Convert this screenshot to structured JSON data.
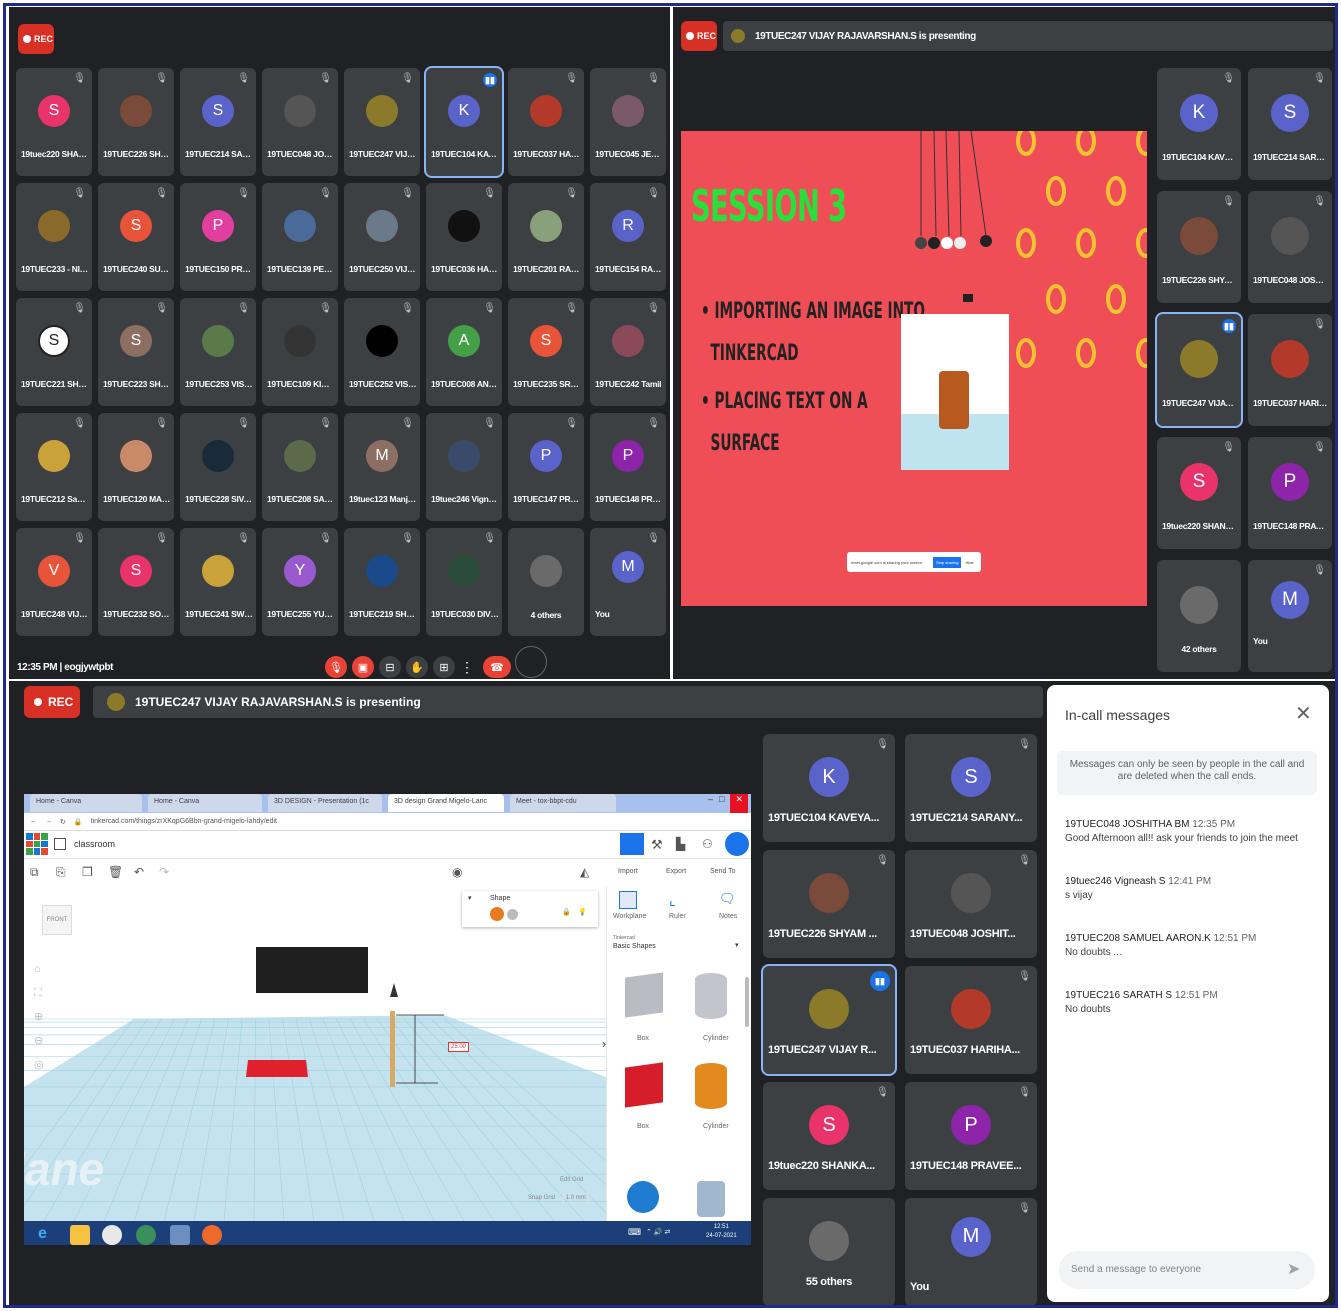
{
  "rec_label": "REC",
  "panel_tl": {
    "time_code": "12:35 PM | eogjywtpbt",
    "tiles": [
      {
        "name": "19tuec220 SHAN...",
        "initial": "S",
        "color": "#e8336b"
      },
      {
        "name": "19TUEC226 SHYA...",
        "initial": "",
        "color": "#7a4a3a"
      },
      {
        "name": "19TUEC214 SARA...",
        "initial": "S",
        "color": "#5a63c9"
      },
      {
        "name": "19TUEC048 JOSH...",
        "initial": "",
        "color": "#555555"
      },
      {
        "name": "19TUEC247 VIJAY...",
        "initial": "",
        "color": "#8a7a2a"
      },
      {
        "name": "19TUEC104 KAVE...",
        "initial": "K",
        "color": "#5a63c9",
        "active": true
      },
      {
        "name": "19TUEC037 HARI...",
        "initial": "",
        "color": "#b33a2a"
      },
      {
        "name": "19TUEC045 JENIF...",
        "initial": "",
        "color": "#7a5a6a"
      },
      {
        "name": "19TUEC233 - NIT...",
        "initial": "",
        "color": "#8a6a2a"
      },
      {
        "name": "19TUEC240 SUSH...",
        "initial": "S",
        "color": "#e8543a"
      },
      {
        "name": "19TUEC150 PREE...",
        "initial": "P",
        "color": "#e03fa0"
      },
      {
        "name": "19TUEC139 PERIN...",
        "initial": "",
        "color": "#4a6a9a"
      },
      {
        "name": "19TUEC250 VIJAY...",
        "initial": "",
        "color": "#6a7a8a"
      },
      {
        "name": "19TUEC036 HARE...",
        "initial": "",
        "color": "#111111"
      },
      {
        "name": "19TUEC201 RANJ...",
        "initial": "",
        "color": "#8aa07a"
      },
      {
        "name": "19TUEC154 RAJA ...",
        "initial": "R",
        "color": "#5a63c9"
      },
      {
        "name": "19TUEC221 SHAN...",
        "initial": "S",
        "color": "#ffffff",
        "dark": true
      },
      {
        "name": "19TUEC223 SHRE...",
        "initial": "S",
        "color": "#8d6e63"
      },
      {
        "name": "19TUEC253 VISH...",
        "initial": "",
        "color": "#5a7a4a"
      },
      {
        "name": "19TUEC109 KIRA...",
        "initial": "",
        "color": "#333333"
      },
      {
        "name": "19TUEC252 VISH...",
        "initial": "",
        "color": "#000000"
      },
      {
        "name": "19TUEC008 ANN ...",
        "initial": "A",
        "color": "#43a047"
      },
      {
        "name": "19TUEC235 SRUT...",
        "initial": "S",
        "color": "#e8543a"
      },
      {
        "name": "19TUEC242 Tamil",
        "initial": "",
        "color": "#8a4a5a"
      },
      {
        "name": "19TUEC212 Sanka...",
        "initial": "",
        "color": "#c9a33a"
      },
      {
        "name": "19TUEC120 MAD...",
        "initial": "",
        "color": "#c98a6a"
      },
      {
        "name": "19TUEC228 SIVA...",
        "initial": "",
        "color": "#1a2a3a"
      },
      {
        "name": "19TUEC208 SAM...",
        "initial": "",
        "color": "#5a6a4a"
      },
      {
        "name": "19tuec123 Manjul...",
        "initial": "M",
        "color": "#8d6e63"
      },
      {
        "name": "19tuec246 Vigne...",
        "initial": "",
        "color": "#3a4a6a"
      },
      {
        "name": "19TUEC147 PRAV...",
        "initial": "P",
        "color": "#5a63c9"
      },
      {
        "name": "19TUEC148 PRAV...",
        "initial": "P",
        "color": "#8e24aa"
      },
      {
        "name": "19TUEC248 VIJAY...",
        "initial": "V",
        "color": "#e8543a"
      },
      {
        "name": "19TUEC232 SOW...",
        "initial": "S",
        "color": "#e8336b"
      },
      {
        "name": "19TUEC241 SWED...",
        "initial": "",
        "color": "#c9a33a"
      },
      {
        "name": "19TUEC255 YUVA...",
        "initial": "Y",
        "color": "#9b59d0"
      },
      {
        "name": "19TUEC219 SHAN...",
        "initial": "",
        "color": "#1a4a8a"
      },
      {
        "name": "19TUEC030 DIVY...",
        "initial": "",
        "color": "#2a4a3a"
      },
      {
        "name": "4 others",
        "initial": "",
        "color": "#6a6a6a",
        "others": true
      },
      {
        "name": "You",
        "initial": "M",
        "color": "#5a63c9",
        "you": true
      }
    ]
  },
  "panel_tr": {
    "presenting": "19TUEC247 VIJAY RAJAVARSHAN.S is presenting",
    "slide": {
      "title": "SESSION 3",
      "bullet1_line1": "IMPORTING AN IMAGE INTO",
      "bullet1_line2": "TINKERCAD",
      "bullet2_line1": "PLACING TEXT ON A",
      "bullet2_line2": "SURFACE",
      "share_text": "meet.google.com is sharing your screen",
      "stop_sharing": "Stop sharing",
      "hide": "Hide"
    },
    "tiles": [
      {
        "name": "19TUEC104 KAVEYA...",
        "initial": "K",
        "color": "#5a63c9"
      },
      {
        "name": "19TUEC214 SARANY...",
        "initial": "S",
        "color": "#5a63c9"
      },
      {
        "name": "19TUEC226 SHYAM ...",
        "initial": "",
        "color": "#7a4a3a"
      },
      {
        "name": "19TUEC048 JOSHIT...",
        "initial": "",
        "color": "#555555"
      },
      {
        "name": "19TUEC247 VIJAY R...",
        "initial": "",
        "color": "#8a7a2a",
        "active": true
      },
      {
        "name": "19TUEC037 HARIHA...",
        "initial": "",
        "color": "#b33a2a"
      },
      {
        "name": "19tuec220 SHANKA...",
        "initial": "S",
        "color": "#e8336b"
      },
      {
        "name": "19TUEC148 PRAVEE...",
        "initial": "P",
        "color": "#8e24aa"
      },
      {
        "name": "42 others",
        "initial": "",
        "color": "#6a6a6a",
        "others": true
      },
      {
        "name": "You",
        "initial": "M",
        "color": "#5a63c9",
        "you": true
      }
    ]
  },
  "panel_bottom": {
    "presenting": "19TUEC247 VIJAY RAJAVARSHAN.S is presenting",
    "browser": {
      "tabs": [
        "Home - Canva",
        "Home - Canva",
        "3D DESIGN - Presentation (1c",
        "3D design Grand Migelo-Lanc",
        "Meet - tox-bbpt-cdu"
      ],
      "url": "tinkercad.com/things/zrXKqpG6Bbn-grand-migelo-lahdy/edit",
      "project": "classroom",
      "import": "Import",
      "export": "Export",
      "send_to": "Send To",
      "workplane": "Workplane",
      "ruler": "Ruler",
      "notes": "Notes",
      "category_small": "Tinkercad",
      "category": "Basic Shapes",
      "shape_label": "Shape",
      "front_label": "FRONT",
      "dimension": "25.00",
      "plane_text": "plane",
      "edit_grid": "Edit Grid",
      "snap_grid": "Snap Grid",
      "snap_value": "1.0 mm",
      "shapes": [
        "Box",
        "Cylinder",
        "Box",
        "Cylinder"
      ],
      "clock_time": "12:51",
      "clock_date": "24-07-2021"
    },
    "tiles": [
      {
        "name": "19TUEC104 KAVEYA...",
        "initial": "K",
        "color": "#5a63c9"
      },
      {
        "name": "19TUEC214 SARANY...",
        "initial": "S",
        "color": "#5a63c9"
      },
      {
        "name": "19TUEC226 SHYAM ...",
        "initial": "",
        "color": "#7a4a3a"
      },
      {
        "name": "19TUEC048 JOSHIT...",
        "initial": "",
        "color": "#555555"
      },
      {
        "name": "19TUEC247 VIJAY R...",
        "initial": "",
        "color": "#8a7a2a",
        "active": true
      },
      {
        "name": "19TUEC037 HARIHA...",
        "initial": "",
        "color": "#b33a2a"
      },
      {
        "name": "19tuec220 SHANKA...",
        "initial": "S",
        "color": "#e8336b"
      },
      {
        "name": "19TUEC148 PRAVEE...",
        "initial": "P",
        "color": "#8e24aa"
      },
      {
        "name": "55 others",
        "initial": "",
        "color": "#6a6a6a",
        "others": true
      },
      {
        "name": "You",
        "initial": "M",
        "color": "#5a63c9",
        "you": true
      }
    ],
    "messages": {
      "title": "In-call messages",
      "notice": "Messages can only be seen by people in the call and are deleted when the call ends.",
      "items": [
        {
          "sender": "19TUEC048 JOSHITHA BM",
          "time": "12:35 PM",
          "text": "Good Afternoon all!! ask your friends to join the meet"
        },
        {
          "sender": "19tuec246 Vigneash S",
          "time": "12:41 PM",
          "text": "s vijay"
        },
        {
          "sender": "19TUEC208 SAMUEL AARON.K",
          "time": "12:51 PM",
          "text": "No doubts ..."
        },
        {
          "sender": "19TUEC216 SARATH S",
          "time": "12:51 PM",
          "text": "No doubts"
        }
      ],
      "input_placeholder": "Send a message to everyone"
    }
  }
}
